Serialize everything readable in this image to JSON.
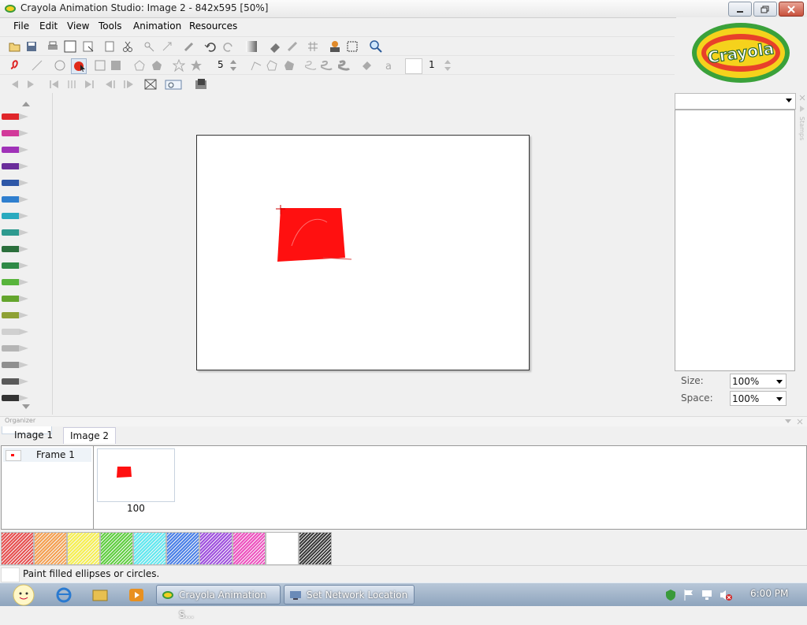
{
  "window": {
    "title": "Crayola Animation Studio: Image 2 - 842x595 [50%]"
  },
  "menu": [
    "File",
    "Edit",
    "View",
    "Tools",
    "Animation",
    "Resources"
  ],
  "toolbar": {
    "brush_size": "5",
    "opacity_value": "1"
  },
  "stamps": {
    "size_label": "Size:",
    "size_value": "100%",
    "space_label": "Space:",
    "space_value": "100%",
    "side_label": "Stamps"
  },
  "organizer": {
    "label": "Organizer",
    "tabs": [
      "Image 1",
      "Image 2"
    ],
    "frame_name": "Frame 1",
    "frame_duration": "100"
  },
  "status": {
    "hint": "Paint filled ellipses or circles."
  },
  "taskbar": {
    "tasks": [
      "Crayola Animation S...",
      "Set Network Location"
    ],
    "clock": "6:00 PM"
  },
  "colors": {
    "crayons": [
      "#e0262a",
      "#d23a9a",
      "#a032b8",
      "#6a2d9a",
      "#2e57a7",
      "#2f7fcf",
      "#29aabf",
      "#2e9a8f",
      "#2b6f3c",
      "#2f8a47",
      "#58b43c",
      "#64a52d",
      "#8ea135",
      "#d0d0d0",
      "#b5b5b5",
      "#8f8f8f",
      "#5a5a5a",
      "#333333"
    ],
    "swatches": [
      "#e85050",
      "#f5a050",
      "#f7f050",
      "#60d040",
      "#60e8f0",
      "#4a80e8",
      "#a050e0",
      "#ef50c0",
      "#ffffff",
      "#3a3a3a"
    ],
    "shape_fill": "#ff1010"
  }
}
